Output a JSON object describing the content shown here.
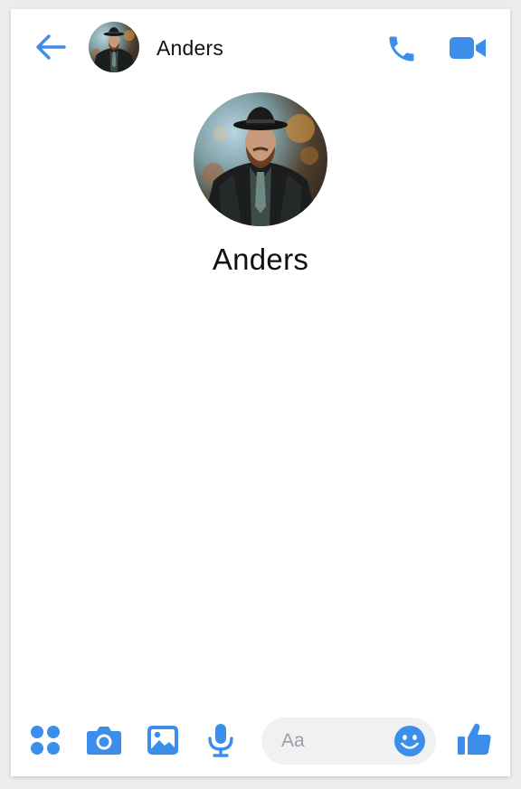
{
  "theme": {
    "accent": "#3b8ee9",
    "background": "#ffffff",
    "composer_background": "#f0f1f3",
    "text": "#111111",
    "placeholder": "#9a9ea4"
  },
  "header": {
    "back_icon": "arrow-left-icon",
    "contact_name": "Anders",
    "call_icon": "phone-icon",
    "video_icon": "video-camera-icon"
  },
  "profile": {
    "name": "Anders"
  },
  "footer": {
    "tools": [
      "apps-grid-icon",
      "camera-icon",
      "image-icon",
      "microphone-icon"
    ],
    "composer": {
      "placeholder": "Aa",
      "value": ""
    },
    "emoji_icon": "smiley-icon",
    "like_icon": "thumbs-up-icon"
  }
}
